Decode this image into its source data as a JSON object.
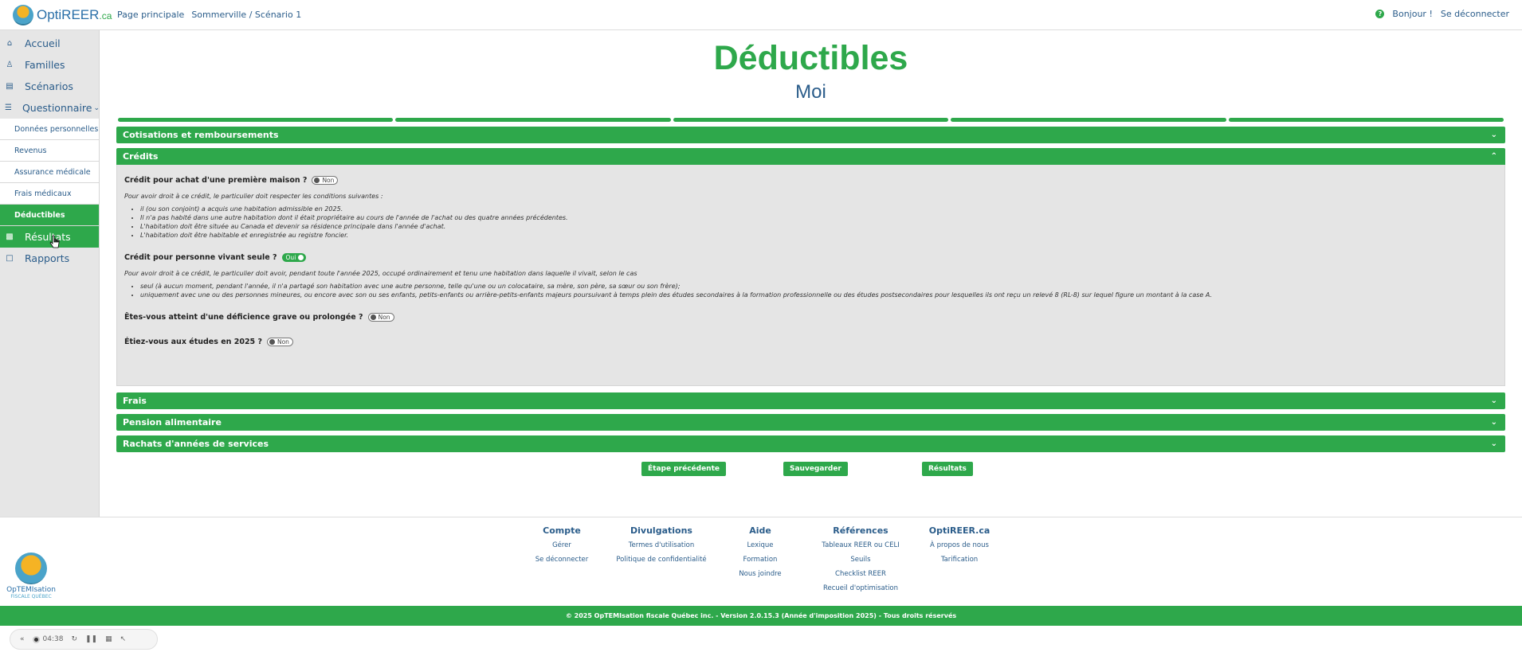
{
  "header": {
    "logo_text": "OptiREER",
    "logo_suffix": ".ca",
    "breadcrumbs": [
      "Page principale",
      "Sommerville / Scénario 1"
    ],
    "greeting": "Bonjour !",
    "logout": "Se déconnecter"
  },
  "sidebar": {
    "items": [
      {
        "label": "Accueil",
        "icon": "home-icon"
      },
      {
        "label": "Familles",
        "icon": "users-icon"
      },
      {
        "label": "Scénarios",
        "icon": "scenarios-icon"
      },
      {
        "label": "Questionnaire",
        "icon": "list-icon"
      }
    ],
    "sub_items": [
      "Données personnelles",
      "Revenus",
      "Assurance médicale",
      "Frais médicaux",
      "Déductibles"
    ],
    "bottom_items": [
      {
        "label": "Résultats",
        "icon": "chart-icon"
      },
      {
        "label": "Rapports",
        "icon": "report-icon"
      }
    ]
  },
  "main": {
    "title": "Déductibles",
    "subtitle": "Moi",
    "progress_segments": 5,
    "sections": {
      "cotisations": "Cotisations et remboursements",
      "credits": "Crédits",
      "frais": "Frais",
      "pension": "Pension alimentaire",
      "rachats": "Rachats d'années de services"
    },
    "credits": {
      "q1": {
        "label": "Crédit pour achat d'une première maison ?",
        "value": "Non"
      },
      "q1_info": "Pour avoir droit à ce crédit, le particulier doit respecter les conditions suivantes :",
      "q1_list": [
        "il (ou son conjoint) a acquis une habitation admissible en 2025.",
        "Il n'a pas habité dans une autre habitation dont il était propriétaire au cours de l'année de l'achat ou des quatre années précédentes.",
        "L'habitation doit être située au Canada et devenir sa résidence principale dans l'année d'achat.",
        "L'habitation doit être habitable et enregistrée au registre foncier."
      ],
      "q2": {
        "label": "Crédit pour personne vivant seule ?",
        "value": "Oui"
      },
      "q2_info": "Pour avoir droit à ce crédit, le particulier doit avoir, pendant toute l'année 2025, occupé ordinairement et tenu une habitation dans laquelle il vivait, selon le cas",
      "q2_list": [
        "seul (à aucun moment, pendant l'année, il n'a partagé son habitation avec une autre personne, telle qu'une ou un colocataire, sa mère, son père, sa sœur ou son frère);",
        "uniquement avec une ou des personnes mineures, ou encore avec son ou ses enfants, petits-enfants ou arrière-petits-enfants majeurs poursuivant à temps plein des études secondaires à la formation professionnelle ou des études postsecondaires pour lesquelles ils ont reçu un relevé 8 (RL-8) sur lequel figure un montant à la case A."
      ],
      "q3": {
        "label": "Êtes-vous atteint d'une déficience grave ou prolongée ?",
        "value": "Non"
      },
      "q4": {
        "label": "Étiez-vous aux études en 2025 ?",
        "value": "Non"
      }
    },
    "buttons": {
      "previous": "Étape précédente",
      "save": "Sauvegarder",
      "results": "Résultats"
    }
  },
  "footer": {
    "brand": "OpTEMIsation",
    "brand_sub": "FISCALE QUÉBEC",
    "columns": [
      {
        "title": "Compte",
        "links": [
          "Gérer",
          "Se déconnecter"
        ]
      },
      {
        "title": "Divulgations",
        "links": [
          "Termes d'utilisation",
          "Politique de confidentialité"
        ]
      },
      {
        "title": "Aide",
        "links": [
          "Lexique",
          "Formation",
          "Nous joindre"
        ]
      },
      {
        "title": "Références",
        "links": [
          "Tableaux REER ou CELI",
          "Seuils",
          "Checklist REER",
          "Recueil d'optimisation"
        ]
      },
      {
        "title": "OptiREER.ca",
        "links": [
          "À propos de nous",
          "Tarification"
        ]
      }
    ],
    "copyright": "© 2025 OpTEMIsation fiscale Québec inc. - Version 2.0.15.3 (Année d'imposition 2025) - Tous droits réservés"
  },
  "recorder": {
    "time": "04:38"
  },
  "colors": {
    "accent": "#2ea84b",
    "link": "#2a5c8a"
  }
}
